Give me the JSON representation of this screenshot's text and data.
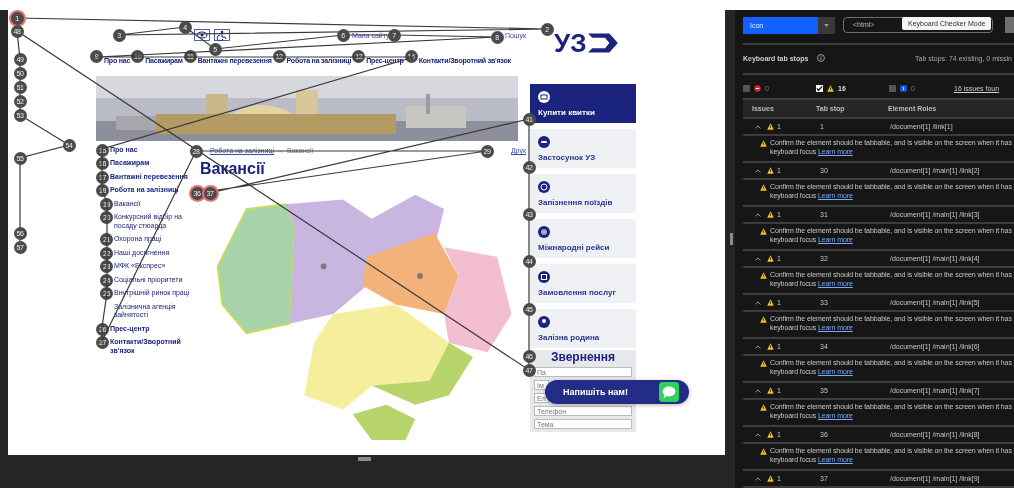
{
  "site": {
    "top_links": [
      {
        "kind": "sitemap",
        "label": "Мапа сайту"
      },
      {
        "kind": "search",
        "label": "Пошук"
      }
    ],
    "logo": "УЗ",
    "nav": [
      "Про нас",
      "Пасажирам",
      "Вантажні перевезення",
      "Робота на залізниці",
      "Прес-центр",
      "Контакти/Зворотний зв'язок"
    ],
    "sidebar": [
      {
        "label": "Про нас"
      },
      {
        "label": "Пасажирам"
      },
      {
        "label": "Вантажні перевезення"
      },
      {
        "label": "Робота на залізниці",
        "children": [
          {
            "label": "Вакансії"
          },
          {
            "label": "Конкурсний відбір на посаду стюарда"
          },
          {
            "label": "Охорона праці"
          },
          {
            "label": "Наші досягнення"
          },
          {
            "label": "МФК «Експрес»"
          },
          {
            "label": "Соціальні пріоритети"
          },
          {
            "label": "Внутрішній ринок праці"
          },
          {
            "label": "Залізнична агенція зайнятості"
          }
        ]
      },
      {
        "label": "Прес-центр"
      },
      {
        "label": "Контакти/Зворотний зв'язок"
      }
    ],
    "breadcrumb": [
      "Робота на залізниці",
      "Вакансії"
    ],
    "breadcrumb_separator": "→",
    "print": "Друк",
    "heading": "Вакансії",
    "cards": [
      {
        "kind": "tickets",
        "label": "Купити квитки",
        "selected": true
      },
      {
        "kind": "app",
        "label": "Застосунок УЗ",
        "selected": false
      },
      {
        "kind": "delay",
        "label": "Запізнення поїздів",
        "selected": false
      },
      {
        "kind": "globe",
        "label": "Міжнародні рейси",
        "selected": false
      },
      {
        "kind": "service",
        "label": "Замовлення послуг",
        "selected": false
      },
      {
        "kind": "family",
        "label": "Залізна родина",
        "selected": false
      }
    ],
    "form": {
      "title": "Звернення",
      "fields": [
        {
          "placeholder": "Па"
        },
        {
          "placeholder": "Ім"
        },
        {
          "placeholder": "Ел"
        },
        {
          "placeholder": "Телефон"
        },
        {
          "placeholder": "Тема"
        }
      ]
    },
    "chat_button": "Напишіть нам!"
  },
  "tab_stops": [
    {
      "label": "1",
      "flagged": true
    },
    {
      "label": "2",
      "flagged": false
    },
    {
      "label": "3",
      "flagged": false
    },
    {
      "label": "4",
      "flagged": false
    },
    {
      "label": "5",
      "flagged": false
    },
    {
      "label": "6",
      "flagged": false
    },
    {
      "label": "7",
      "flagged": false
    },
    {
      "label": "8",
      "flagged": false
    },
    {
      "label": "9",
      "flagged": false
    },
    {
      "label": "10",
      "flagged": false
    },
    {
      "label": "11",
      "flagged": false
    },
    {
      "label": "12",
      "flagged": false
    },
    {
      "label": "13",
      "flagged": false
    },
    {
      "label": "14",
      "flagged": false
    },
    {
      "label": "15",
      "flagged": false
    },
    {
      "label": "16",
      "flagged": false
    },
    {
      "label": "17",
      "flagged": false
    },
    {
      "label": "18",
      "flagged": false
    },
    {
      "label": "19",
      "flagged": false
    },
    {
      "label": "20",
      "flagged": false
    },
    {
      "label": "21",
      "flagged": false
    },
    {
      "label": "22",
      "flagged": false
    },
    {
      "label": "23",
      "flagged": false
    },
    {
      "label": "24",
      "flagged": false
    },
    {
      "label": "25",
      "flagged": false
    },
    {
      "label": "26",
      "flagged": false
    },
    {
      "label": "27",
      "flagged": false
    },
    {
      "label": "28",
      "flagged": false
    },
    {
      "label": "29",
      "flagged": false
    },
    {
      "label": "36",
      "flagged": true
    },
    {
      "label": "37",
      "flagged": true
    },
    {
      "label": "41",
      "flagged": false
    },
    {
      "label": "42",
      "flagged": false
    },
    {
      "label": "43",
      "flagged": false
    },
    {
      "label": "44",
      "flagged": false
    },
    {
      "label": "45",
      "flagged": false
    },
    {
      "label": "46",
      "flagged": false
    },
    {
      "label": "47",
      "flagged": false
    },
    {
      "label": "48",
      "flagged": false
    },
    {
      "label": "49",
      "flagged": false
    },
    {
      "label": "50",
      "flagged": false
    },
    {
      "label": "51",
      "flagged": false
    },
    {
      "label": "52",
      "flagged": false
    },
    {
      "label": "53",
      "flagged": false
    },
    {
      "label": "54",
      "flagged": false
    },
    {
      "label": "55",
      "flagged": false
    },
    {
      "label": "56",
      "flagged": false
    },
    {
      "label": "57",
      "flagged": false
    }
  ],
  "checker": {
    "select": "Icon",
    "path_field": "<html>",
    "tooltip": "Keyboard Checker Mode",
    "title": "Keyboard tab stops",
    "summary": "Tab stops: 74 existing, 0 missin",
    "filters": [
      {
        "kind": "violation",
        "checked": false,
        "count": "0"
      },
      {
        "kind": "warning",
        "checked": true,
        "count": "16"
      },
      {
        "kind": "recommendation",
        "checked": false,
        "count": "0"
      }
    ],
    "issues_found": "16 issues foun",
    "columns": [
      "Issues",
      "Tab stop",
      "Element Roles"
    ],
    "rows": [
      {
        "issues": "1",
        "tab_stop": "1",
        "role": "/document[1] /link[1]",
        "expanded": true,
        "message": "Confirm the element should be tabbable, and is visible on the screen when it has keyboard focus",
        "link": "Learn more"
      },
      {
        "issues": "1",
        "tab_stop": "30",
        "role": "/document[1] /main[1] /link[2]",
        "expanded": true,
        "message": "Confirm the element should be tabbable, and is visible on the screen when it has keyboard focus",
        "link": "Learn more"
      },
      {
        "issues": "1",
        "tab_stop": "31",
        "role": "/document[1] /main[1] /link[3]",
        "expanded": true,
        "message": "Confirm the element should be tabbable, and is visible on the screen when it has keyboard focus",
        "link": "Learn more"
      },
      {
        "issues": "1",
        "tab_stop": "32",
        "role": "/document[1] /main[1] /link[4]",
        "expanded": true,
        "message": "Confirm the element should be tabbable, and is visible on the screen when it has keyboard focus",
        "link": "Learn more"
      },
      {
        "issues": "1",
        "tab_stop": "33",
        "role": "/document[1] /main[1] /link[5]",
        "expanded": true,
        "message": "Confirm the element should be tabbable, and is visible on the screen when it has keyboard focus",
        "link": "Learn more"
      },
      {
        "issues": "1",
        "tab_stop": "34",
        "role": "/document[1] /main[1] /link[6]",
        "expanded": true,
        "message": "Confirm the element should be tabbable, and is visible on the screen when it has keyboard focus",
        "link": "Learn more"
      },
      {
        "issues": "1",
        "tab_stop": "35",
        "role": "/document[1] /main[1] /link[7]",
        "expanded": true,
        "message": "Confirm the element should be tabbable, and is visible on the screen when it has keyboard focus",
        "link": "Learn more"
      },
      {
        "issues": "1",
        "tab_stop": "36",
        "role": "/document[1] /main[1] /link[8]",
        "expanded": true,
        "message": "Confirm the element should be tabbable, and is visible on the screen when it has keyboard focus",
        "link": "Learn more"
      },
      {
        "issues": "1",
        "tab_stop": "37",
        "role": "/document[1] /main[1] /link[9]",
        "expanded": true
      }
    ]
  }
}
